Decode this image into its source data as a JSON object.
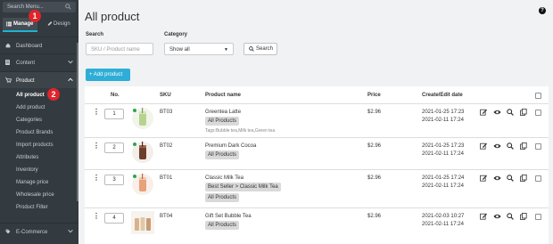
{
  "sidebar": {
    "search_placeholder": "Search Menu...",
    "tabs": {
      "manage": "Manage",
      "design": "Design"
    },
    "badges": {
      "one": "1",
      "two": "2"
    },
    "nav": {
      "dashboard": "Dashboard",
      "content": "Content",
      "product": "Product",
      "ecommerce": "E-Commerce"
    },
    "product_sub": [
      "All product",
      "Add product",
      "Categories",
      "Product Brands",
      "Import products",
      "Attributes",
      "Inventory",
      "Manage price",
      "Wholesale price",
      "Product Filter"
    ],
    "accent_color": "#1cb4d4"
  },
  "main": {
    "title": "All product",
    "help": "?",
    "search": {
      "label": "Search",
      "placeholder": "SKU / Product name"
    },
    "category": {
      "label": "Category",
      "value": "Show all"
    },
    "search_button": "Search",
    "add_button": "+ Add product",
    "add_button_color": "#2eaed6",
    "table": {
      "headers": {
        "no": "No.",
        "sku": "SKU",
        "name": "Product name",
        "price": "Price",
        "date": "Create/Edit date"
      },
      "rows": [
        {
          "no": "1",
          "sku": "BT03",
          "name": "Greentea Latte",
          "category": "All Products",
          "tags": "Tags:Bubble tea,Milk tea,Green tea",
          "price": "$2.96",
          "created": "2021-01-25 17:23",
          "edited": "2021-02-11 17:24",
          "thumb": "green-drink-icon"
        },
        {
          "no": "2",
          "sku": "BT02",
          "name": "Premium Dark Cocoa",
          "category": "All Products",
          "tags": "",
          "price": "$2.96",
          "created": "2021-01-25 17:23",
          "edited": "2021-02-11 17:24",
          "thumb": "cocoa-drink-icon"
        },
        {
          "no": "3",
          "sku": "BT01",
          "name": "Classic Milk Tea",
          "category": "Best Seller > Classic Milk Tea",
          "category2": "All Products",
          "tags": "",
          "price": "$2.96",
          "created": "2021-01-25 17:24",
          "edited": "2021-02-11 17:24",
          "thumb": "milk-tea-icon"
        },
        {
          "no": "4",
          "sku": "BT04",
          "name": "Gift Set Bubble Tea",
          "category": "All Products",
          "tags": "",
          "price": "$2.96",
          "created": "2021-02-03 10:27",
          "edited": "2021-02-11 17:24",
          "thumb": "gift-set-icon"
        }
      ]
    }
  }
}
